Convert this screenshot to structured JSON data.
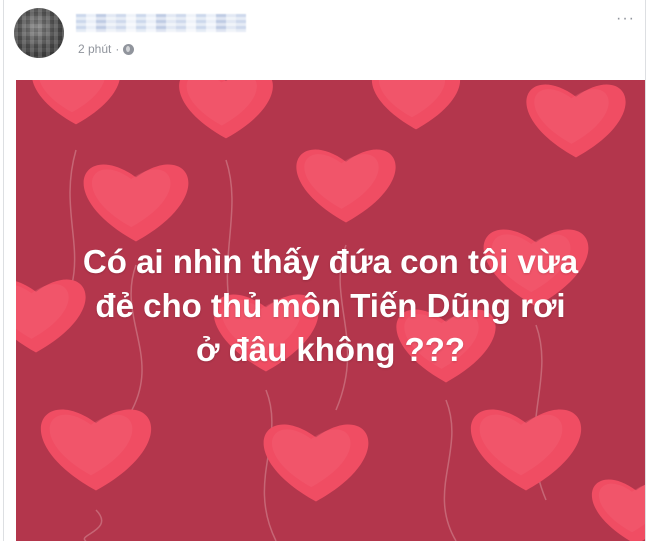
{
  "post": {
    "timestamp": "2 phút",
    "separator": "·",
    "privacy_icon": "globe-icon",
    "options_icon": "more-options-icon",
    "options_label": "···",
    "image_text_lines": [
      "Có ai nhìn thấy đứa con tôi vừa",
      "đẻ cho thủ môn Tiến Dũng rơi",
      "ở đâu không ???"
    ]
  },
  "colors": {
    "image_background": "#b3364c",
    "heart": "#f04d63",
    "heart_highlight": "#f46478",
    "string": "#cf7a88",
    "text": "#ffffff",
    "meta_text": "#90949c"
  }
}
